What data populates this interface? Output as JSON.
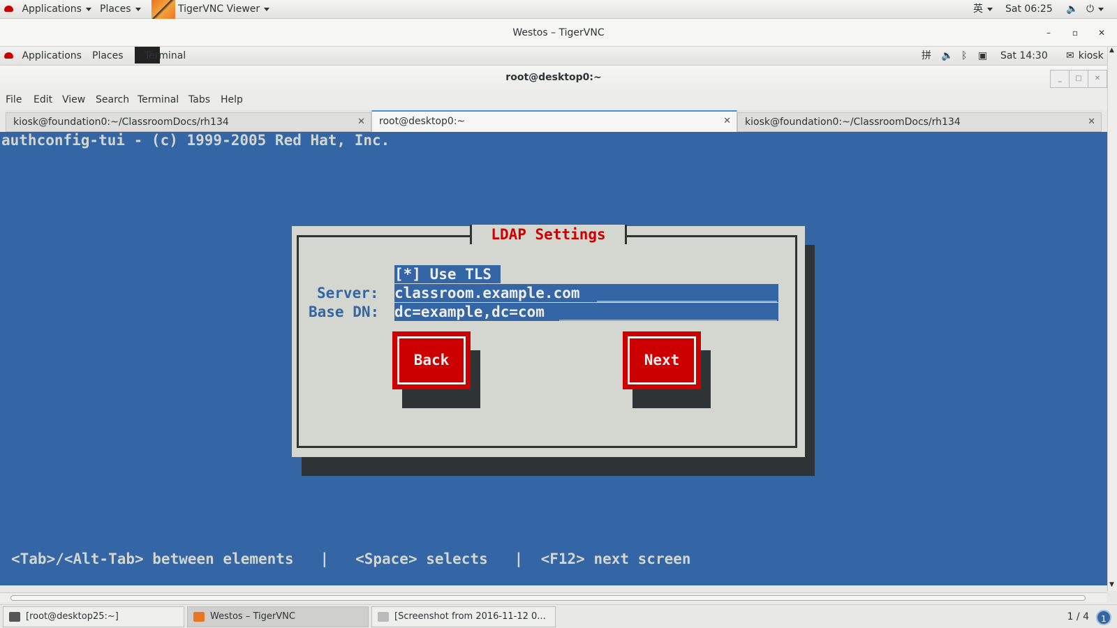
{
  "outer_topbar": {
    "applications": "Applications",
    "places": "Places",
    "active_app": "TigerVNC Viewer",
    "input_method": "英",
    "clock": "Sat 06:25"
  },
  "vnc_window": {
    "title": "Westos – TigerVNC",
    "minimize": "–",
    "maximize": "▫",
    "close": "✕"
  },
  "inner_topbar": {
    "applications": "Applications",
    "places": "Places",
    "active_app": "Terminal",
    "input_method": "拼",
    "clock": "Sat 14:30",
    "user": "kiosk"
  },
  "terminal": {
    "title": "root@desktop0:~",
    "menu": [
      "File",
      "Edit",
      "View",
      "Search",
      "Terminal",
      "Tabs",
      "Help"
    ],
    "tabs": [
      {
        "label": "kiosk@foundation0:~/ClassroomDocs/rh134",
        "active": false
      },
      {
        "label": "root@desktop0:~",
        "active": true
      },
      {
        "label": "kiosk@foundation0:~/ClassroomDocs/rh134",
        "active": false
      }
    ],
    "tab_close": "✕"
  },
  "tui": {
    "header": "authconfig-tui - (c) 1999-2005 Red Hat, Inc.",
    "dialog_title": "LDAP Settings",
    "use_tls": "[*] Use TLS",
    "server_label": "Server:",
    "server_value": "classroom.example.com",
    "basedn_label": "Base DN:",
    "basedn_value": "dc=example,dc=com",
    "back_button": "Back",
    "next_button": "Next",
    "hints": "<Tab>/<Alt-Tab> between elements   |   <Space> selects   |  <F12> next screen"
  },
  "taskbar": {
    "tasks": [
      {
        "label": "[root@desktop25:~]",
        "active": false
      },
      {
        "label": "Westos – TigerVNC",
        "active": true
      },
      {
        "label": "[Screenshot from 2016-11-12 0...",
        "active": false
      }
    ],
    "pager": "1 / 4",
    "notifications": "1"
  }
}
